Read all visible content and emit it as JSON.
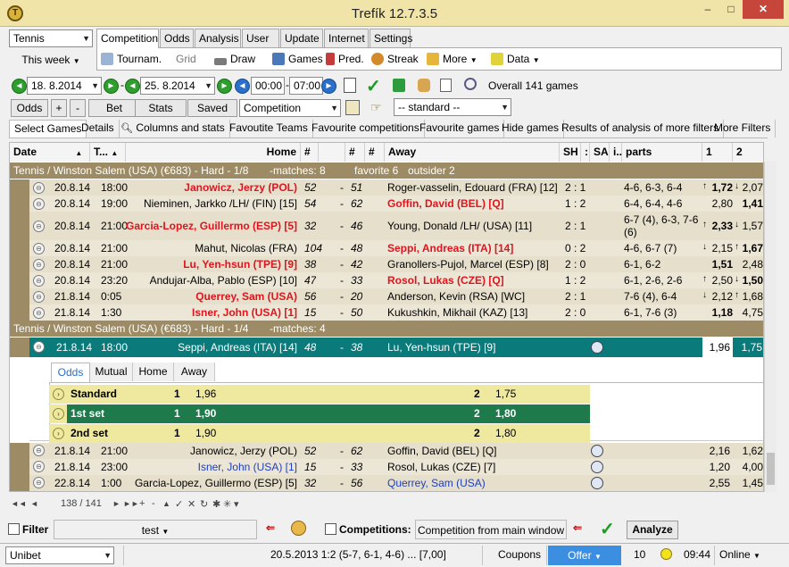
{
  "window": {
    "title": "Trefík 12.7.3.5",
    "min": "–",
    "max": "□",
    "close": "✕"
  },
  "sport_combo": "Tennis",
  "period_label": "This week",
  "top_tabs": [
    "Competition",
    "Odds",
    "Analysis",
    "User",
    "Update",
    "Internet",
    "Settings"
  ],
  "toolbar": {
    "tournam": "Tournam.",
    "grid": "Grid",
    "draw": "Draw",
    "games": "Games",
    "pred": "Pred.",
    "streak": "Streak",
    "more": "More",
    "data": "Data"
  },
  "dates": {
    "from": "18.  8.2014",
    "to": "25.  8.2014",
    "time_from": "00:00",
    "time_to": "07:00",
    "overall": "Overall 141 games"
  },
  "filterbar": {
    "odds": "Odds",
    "plus": "+",
    "minus": "-",
    "bet": "Bet",
    "stats": "Stats",
    "saved": "Saved",
    "competition": "Competition",
    "standard": "-- standard --"
  },
  "subtabs": [
    "Select Games",
    "Details",
    "Columns and stats",
    "Favoutite Teams",
    "Favourite competitions",
    "Favourite games",
    "Hide games",
    "Results of analysis of more filters",
    "More Filters"
  ],
  "columns": {
    "date": "Date",
    "t": "T...",
    "home": "Home",
    "h1": "#",
    "blank": "",
    "h2": "#",
    "h3": "#",
    "away": "Away",
    "sh": "SH",
    "colon": ":",
    "sa": "SA",
    "i": "i..",
    "parts": "parts",
    "o1": "1",
    "o2": "2"
  },
  "group1": {
    "title": "Tennis / Winston Salem (USA) (€683) - Hard - 1/8",
    "matches": "-matches: 8",
    "fav": "favorite 6",
    "out": "outsider 2"
  },
  "rows1": [
    {
      "date": "20.8.14",
      "time": "18:00",
      "home": "Janowicz, Jerzy (POL)",
      "hr": "52",
      "d": "-",
      "ar": "51",
      "away": "Roger-vasselin, Edouard (FRA) [12]",
      "score": "2 : 1",
      "parts": "4-6, 6-3, 6-4",
      "o1": "1,72",
      "o2": "2,07",
      "a1": "↑",
      "a2": "↓"
    },
    {
      "date": "20.8.14",
      "time": "19:00",
      "home": "Nieminen, Jarkko /LH/ (FIN) [15]",
      "hr": "54",
      "d": "-",
      "ar": "62",
      "away": "Goffin, David (BEL) [Q]",
      "score": "1 : 2",
      "parts": "6-4, 6-4, 4-6",
      "o1": "2,80",
      "o2": "1,41",
      "a1": "",
      "a2": ""
    },
    {
      "date": "20.8.14",
      "time": "21:00",
      "home": "Garcia-Lopez, Guillermo (ESP) [5]",
      "hr": "32",
      "d": "-",
      "ar": "46",
      "away": "Young, Donald /LH/ (USA) [11]",
      "score": "2 : 1",
      "parts": "6-7 (4), 6-3, 7-6 (6)",
      "o1": "2,33",
      "o2": "1,57",
      "a1": "↑",
      "a2": "↓"
    },
    {
      "date": "20.8.14",
      "time": "21:00",
      "home": "Mahut, Nicolas (FRA)",
      "hr": "104",
      "d": "-",
      "ar": "48",
      "away": "Seppi, Andreas (ITA) [14]",
      "score": "0 : 2",
      "parts": "4-6, 6-7 (7)",
      "o1": "2,15",
      "o2": "1,67",
      "a1": "↓",
      "a2": "↑"
    },
    {
      "date": "20.8.14",
      "time": "21:00",
      "home": "Lu, Yen-hsun (TPE) [9]",
      "hr": "38",
      "d": "-",
      "ar": "42",
      "away": "Granollers-Pujol, Marcel (ESP) [8]",
      "score": "2 : 0",
      "parts": "6-1, 6-2",
      "o1": "1,51",
      "o2": "2,48",
      "a1": "",
      "a2": ""
    },
    {
      "date": "20.8.14",
      "time": "23:20",
      "home": "Andujar-Alba, Pablo (ESP) [10]",
      "hr": "47",
      "d": "-",
      "ar": "33",
      "away": "Rosol, Lukas (CZE) [Q]",
      "score": "1 : 2",
      "parts": "6-1, 2-6, 2-6",
      "o1": "2,50",
      "o2": "1,50",
      "a1": "↑",
      "a2": "↓"
    },
    {
      "date": "21.8.14",
      "time": "0:05",
      "home": "Querrey, Sam (USA)",
      "hr": "56",
      "d": "-",
      "ar": "20",
      "away": "Anderson, Kevin (RSA) [WC]",
      "score": "2 : 1",
      "parts": "7-6 (4), 6-4",
      "o1": "2,12",
      "o2": "1,68",
      "a1": "↓",
      "a2": "↑"
    },
    {
      "date": "21.8.14",
      "time": "1:30",
      "home": "Isner, John (USA) [1]",
      "hr": "15",
      "d": "-",
      "ar": "50",
      "away": "Kukushkin, Mikhail (KAZ) [13]",
      "score": "2 : 0",
      "parts": "6-1, 7-6 (3)",
      "o1": "1,18",
      "o2": "4,75",
      "a1": "",
      "a2": ""
    }
  ],
  "group2": {
    "title": "Tennis / Winston Salem (USA) (€683) - Hard - 1/4",
    "matches": "-matches: 4"
  },
  "sel_row": {
    "date": "21.8.14",
    "time": "18:00",
    "home": "Seppi, Andreas (ITA) [14]",
    "hr": "48",
    "d": "-",
    "ar": "38",
    "away": "Lu, Yen-hsun (TPE) [9]",
    "o1": "1,96",
    "o2": "1,75"
  },
  "detail_tabs": [
    "Odds",
    "Mutual",
    "Home",
    "Away"
  ],
  "detail_rows": [
    {
      "label": "Standard",
      "k1": "1",
      "v1": "1,96",
      "k2": "2",
      "v2": "1,75"
    },
    {
      "label": "1st set",
      "k1": "1",
      "v1": "1,90",
      "k2": "2",
      "v2": "1,80"
    },
    {
      "label": "2nd set",
      "k1": "1",
      "v1": "1,90",
      "k2": "2",
      "v2": "1,80"
    }
  ],
  "rows2": [
    {
      "date": "21.8.14",
      "time": "21:00",
      "home": "Janowicz, Jerzy (POL)",
      "hr": "52",
      "d": "-",
      "ar": "62",
      "away": "Goffin, David (BEL) [Q]",
      "o1": "2,16",
      "o2": "1,62"
    },
    {
      "date": "21.8.14",
      "time": "23:00",
      "home": "Isner, John (USA) [1]",
      "hr": "15",
      "d": "-",
      "ar": "33",
      "away": "Rosol, Lukas (CZE) [7]",
      "o1": "1,20",
      "o2": "4,00"
    },
    {
      "date": "22.8.14",
      "time": "1:00",
      "home": "Garcia-Lopez, Guillermo (ESP) [5]",
      "hr": "32",
      "d": "-",
      "ar": "56",
      "away": "Querrey, Sam (USA)",
      "o1": "2,55",
      "o2": "1,45"
    }
  ],
  "nav": {
    "first": "◄◄",
    "prev": "◄",
    "pos": "138 / 141",
    "next": "►",
    "last": "►►",
    "add": "+",
    "del": "-",
    "up": "▲",
    "ok": "✓",
    "cancel": "✕",
    "refresh": "↻",
    "star": "✱",
    "star2": "✳",
    "filter": "▾"
  },
  "filter_row": {
    "filter": "Filter",
    "test": "test",
    "competitions": "Competitions:",
    "comp_value": "Competition from main window",
    "analyze": "Analyze"
  },
  "status": {
    "bookie": "Unibet",
    "info": "20.5.2013 1:2 (5-7, 6-1, 4-6) ... [7,00]",
    "coupons": "Coupons",
    "offer": "Offer",
    "count": "10",
    "clock": "09:44",
    "online": "Online"
  },
  "colors": {
    "accent": "#0b7a7a",
    "group": "#9c8b64",
    "red": "#e0141e"
  }
}
